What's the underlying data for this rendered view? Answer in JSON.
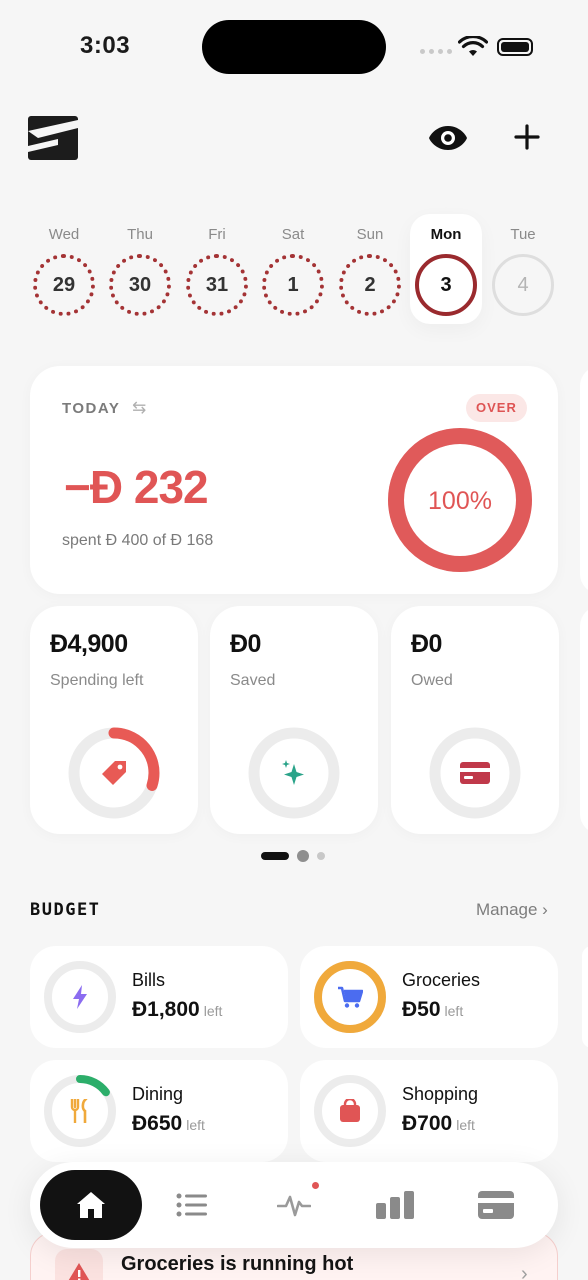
{
  "status_bar": {
    "time": "3:03"
  },
  "days": [
    {
      "name": "Wed",
      "date": "29",
      "state": "dotted"
    },
    {
      "name": "Thu",
      "date": "30",
      "state": "dotted"
    },
    {
      "name": "Fri",
      "date": "31",
      "state": "dotted"
    },
    {
      "name": "Sat",
      "date": "1",
      "state": "dotted"
    },
    {
      "name": "Sun",
      "date": "2",
      "state": "dotted"
    },
    {
      "name": "Mon",
      "date": "3",
      "state": "selected"
    },
    {
      "name": "Tue",
      "date": "4",
      "state": "future"
    }
  ],
  "today": {
    "label": "TODAY",
    "badge": "OVER",
    "amount": "−Đ 232",
    "sub": "spent Đ 400 of Đ 168",
    "percent_label": "100%",
    "percent": 1.0
  },
  "summary": [
    {
      "amount": "Đ4,900",
      "label": "Spending left",
      "icon": "tag-icon",
      "progress": 0.3,
      "color": "#e85a55"
    },
    {
      "amount": "Đ0",
      "label": "Saved",
      "icon": "sparkle-icon",
      "progress": 0,
      "color": "#2aa389"
    },
    {
      "amount": "Đ0",
      "label": "Owed",
      "icon": "card-icon",
      "progress": 0,
      "color": "#c0394a"
    }
  ],
  "budget": {
    "title": "BUDGET",
    "manage": "Manage",
    "left_word": "left",
    "items": [
      {
        "name": "Bills",
        "amount": "Đ1,800",
        "icon": "bolt-icon",
        "progress": 0,
        "color": "#8b6cf0"
      },
      {
        "name": "Groceries",
        "amount": "Đ50",
        "icon": "cart-icon",
        "progress": 1.0,
        "color": "#f0a93b"
      },
      {
        "name": "Dining",
        "amount": "Đ650",
        "icon": "fork-knife-icon",
        "progress": 0.15,
        "color": "#2cae6a"
      },
      {
        "name": "Shopping",
        "amount": "Đ700",
        "icon": "bag-icon",
        "progress": 0,
        "color": "#e05555"
      }
    ]
  },
  "nav": [
    "home-icon",
    "list-icon",
    "pulse-icon",
    "bar-chart-icon",
    "card-icon"
  ],
  "toast": {
    "text": "Groceries is running hot"
  }
}
